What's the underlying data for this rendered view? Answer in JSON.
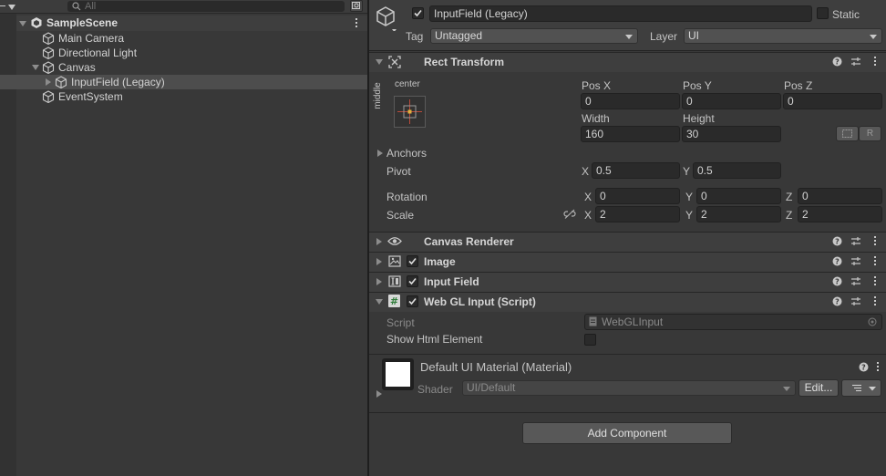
{
  "hierarchy": {
    "search_placeholder": "All",
    "scene_name": "SampleScene",
    "items": [
      {
        "label": "Main Camera"
      },
      {
        "label": "Directional Light"
      },
      {
        "label": "Canvas"
      },
      {
        "label": "InputField (Legacy)"
      },
      {
        "label": "EventSystem"
      }
    ]
  },
  "inspector": {
    "object_name": "InputField (Legacy)",
    "static_label": "Static",
    "tag_label": "Tag",
    "tag_value": "Untagged",
    "layer_label": "Layer",
    "layer_value": "UI",
    "rect_transform": {
      "title": "Rect Transform",
      "anchor_h": "center",
      "anchor_v": "middle",
      "pos_x_label": "Pos X",
      "pos_x": "0",
      "pos_y_label": "Pos Y",
      "pos_y": "0",
      "pos_z_label": "Pos Z",
      "pos_z": "0",
      "width_label": "Width",
      "width": "160",
      "height_label": "Height",
      "height": "30",
      "raw_button": "R",
      "anchors_label": "Anchors",
      "pivot_label": "Pivot",
      "pivot_x": "0.5",
      "pivot_y": "0.5",
      "rotation_label": "Rotation",
      "rot_x": "0",
      "rot_y": "0",
      "rot_z": "0",
      "scale_label": "Scale",
      "scale_x": "2",
      "scale_y": "2",
      "scale_z": "2",
      "axis_x": "X",
      "axis_y": "Y",
      "axis_z": "Z"
    },
    "components": {
      "canvas_renderer": "Canvas Renderer",
      "image": "Image",
      "input_field": "Input Field",
      "webgl_input": "Web GL Input (Script)"
    },
    "script_label": "Script",
    "script_value": "WebGLInput",
    "show_html_label": "Show Html Element",
    "material_title": "Default UI Material (Material)",
    "shader_label": "Shader",
    "shader_value": "UI/Default",
    "edit_button": "Edit...",
    "add_component": "Add Component"
  }
}
